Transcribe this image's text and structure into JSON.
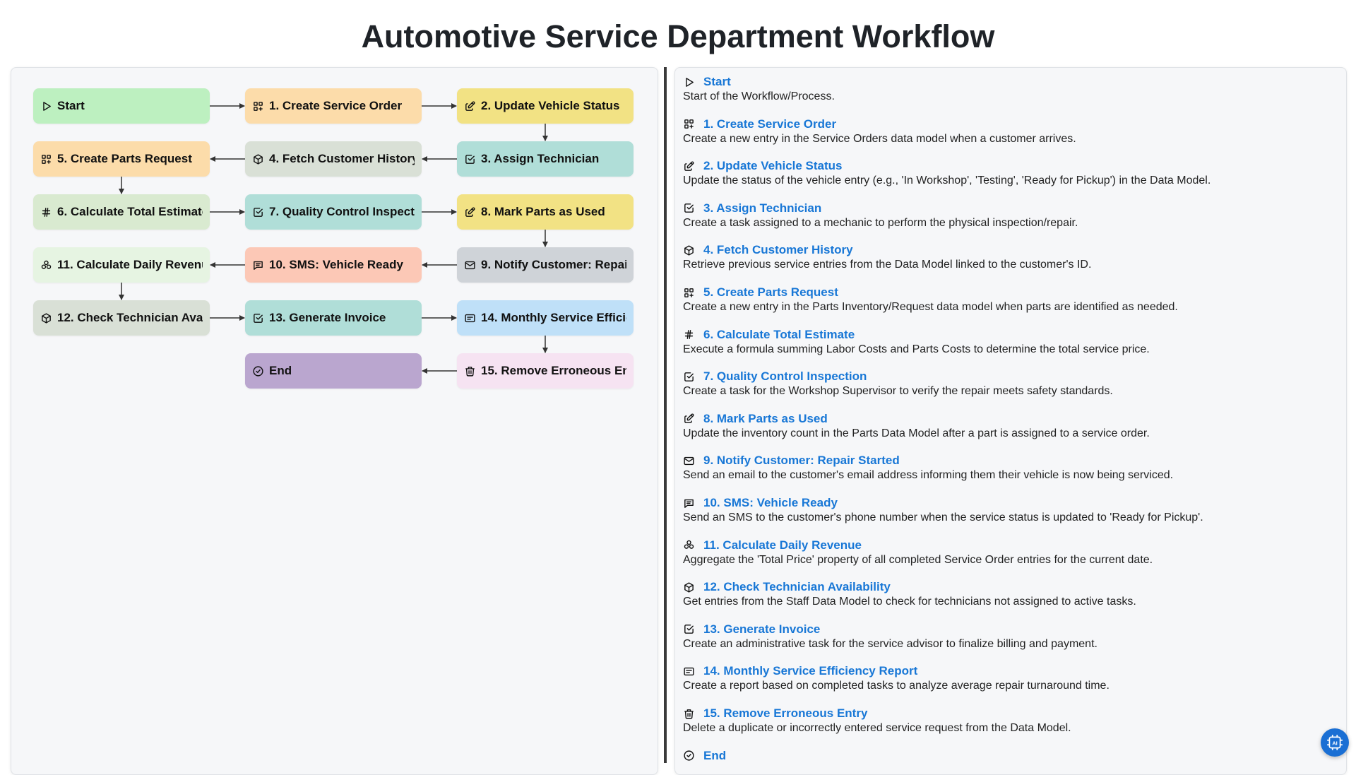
{
  "title": "Automotive Service Department Workflow",
  "colors": {
    "accent": "#1877d6",
    "start": "#bdf0c0",
    "orange": "#fcdcaa",
    "yellow": "#f2e284",
    "teal": "#b0ded8",
    "gray_green": "#d9e0d6",
    "light_green": "#d9ead0",
    "mint": "#e6f4e2",
    "salmon": "#fcc8b6",
    "gray": "#cfd3d8",
    "blue": "#bfe0f8",
    "purple": "#baa6cf",
    "pink": "#f6e3f2"
  },
  "nodes": {
    "start": {
      "label": "Start",
      "icon": "play-icon"
    },
    "n1": {
      "label": "1. Create Service Order",
      "icon": "grid-plus-icon"
    },
    "n2": {
      "label": "2. Update Vehicle Status",
      "icon": "edit-icon"
    },
    "n3": {
      "label": "3. Assign Technician",
      "icon": "checkbox-icon"
    },
    "n4": {
      "label": "4. Fetch Customer History",
      "icon": "cube-icon"
    },
    "n5": {
      "label": "5. Create Parts Request",
      "icon": "grid-plus-icon"
    },
    "n6": {
      "label": "6. Calculate Total Estimate",
      "icon": "hash-icon"
    },
    "n7": {
      "label": "7. Quality Control Inspection",
      "icon": "checkbox-icon"
    },
    "n8": {
      "label": "8. Mark Parts as Used",
      "icon": "edit-icon"
    },
    "n9": {
      "label": "9. Notify Customer: Repair Started",
      "icon": "mail-icon"
    },
    "n10": {
      "label": "10. SMS: Vehicle Ready",
      "icon": "message-icon"
    },
    "n11": {
      "label": "11. Calculate Daily Revenue",
      "icon": "brand-icon"
    },
    "n12": {
      "label": "12. Check Technician Availability",
      "icon": "cube-icon"
    },
    "n13": {
      "label": "13. Generate Invoice",
      "icon": "checkbox-icon"
    },
    "n14": {
      "label": "14. Monthly Service Efficiency Report",
      "icon": "report-icon"
    },
    "n15": {
      "label": "15. Remove Erroneous Entry",
      "icon": "trash-icon"
    },
    "end": {
      "label": "End",
      "icon": "check-circle-icon"
    }
  },
  "steps": [
    {
      "title": "Start",
      "desc": "Start of the Workflow/Process.",
      "icon": "play-icon"
    },
    {
      "title": "1. Create Service Order",
      "desc": "Create a new entry in the Service Orders data model when a customer arrives.",
      "icon": "grid-plus-icon"
    },
    {
      "title": "2. Update Vehicle Status",
      "desc": "Update the status of the vehicle entry (e.g., 'In Workshop', 'Testing', 'Ready for Pickup') in the Data Model.",
      "icon": "edit-icon"
    },
    {
      "title": "3. Assign Technician",
      "desc": "Create a task assigned to a mechanic to perform the physical inspection/repair.",
      "icon": "checkbox-icon"
    },
    {
      "title": "4. Fetch Customer History",
      "desc": "Retrieve previous service entries from the Data Model linked to the customer's ID.",
      "icon": "cube-icon"
    },
    {
      "title": "5. Create Parts Request",
      "desc": "Create a new entry in the Parts Inventory/Request data model when parts are identified as needed.",
      "icon": "grid-plus-icon"
    },
    {
      "title": "6. Calculate Total Estimate",
      "desc": "Execute a formula summing Labor Costs and Parts Costs to determine the total service price.",
      "icon": "hash-icon"
    },
    {
      "title": "7. Quality Control Inspection",
      "desc": "Create a task for the Workshop Supervisor to verify the repair meets safety standards.",
      "icon": "checkbox-icon"
    },
    {
      "title": "8. Mark Parts as Used",
      "desc": "Update the inventory count in the Parts Data Model after a part is assigned to a service order.",
      "icon": "edit-icon"
    },
    {
      "title": "9. Notify Customer: Repair Started",
      "desc": "Send an email to the customer's email address informing them their vehicle is now being serviced.",
      "icon": "mail-icon"
    },
    {
      "title": "10. SMS: Vehicle Ready",
      "desc": "Send an SMS to the customer's phone number when the service status is updated to 'Ready for Pickup'.",
      "icon": "message-icon"
    },
    {
      "title": "11. Calculate Daily Revenue",
      "desc": "Aggregate the 'Total Price' property of all completed Service Order entries for the current date.",
      "icon": "brand-icon"
    },
    {
      "title": "12. Check Technician Availability",
      "desc": "Get entries from the Staff Data Model to check for technicians not assigned to active tasks.",
      "icon": "cube-icon"
    },
    {
      "title": "13. Generate Invoice",
      "desc": "Create an administrative task for the service advisor to finalize billing and payment.",
      "icon": "checkbox-icon"
    },
    {
      "title": "14. Monthly Service Efficiency Report",
      "desc": "Create a report based on completed tasks to analyze average repair turnaround time.",
      "icon": "report-icon"
    },
    {
      "title": "15. Remove Erroneous Entry",
      "desc": "Delete a duplicate or incorrectly entered service request from the Data Model.",
      "icon": "trash-icon"
    },
    {
      "title": "End",
      "desc": "",
      "icon": "check-circle-icon"
    }
  ],
  "fab_icon": "ai-chip-icon"
}
